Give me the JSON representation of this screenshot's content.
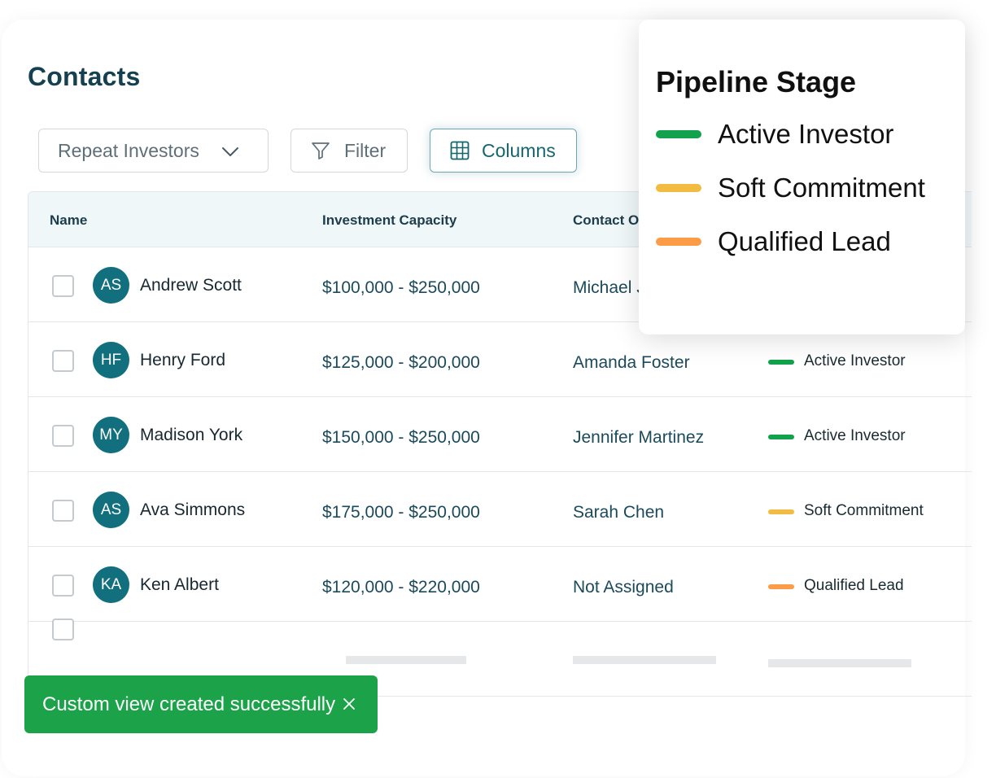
{
  "page": {
    "title": "Contacts"
  },
  "toolbar": {
    "view_select_value": "Repeat Investors",
    "filter_label": "Filter",
    "columns_label": "Columns"
  },
  "table": {
    "headers": [
      "Name",
      "Investment Capacity",
      "Contact O"
    ],
    "rows": [
      {
        "initials": "AS",
        "name": "Andrew Scott",
        "capacity": "$100,000 - $250,000",
        "owner": "Michael J",
        "stage": "",
        "stage_color": ""
      },
      {
        "initials": "HF",
        "name": "Henry Ford",
        "capacity": "$125,000 - $200,000",
        "owner": "Amanda Foster",
        "stage": "Active Investor",
        "stage_color": "#12a14c"
      },
      {
        "initials": "MY",
        "name": "Madison York",
        "capacity": "$150,000 - $250,000",
        "owner": "Jennifer Martinez",
        "stage": "Active Investor",
        "stage_color": "#12a14c"
      },
      {
        "initials": "AS",
        "name": "Ava Simmons",
        "capacity": "$175,000 - $250,000",
        "owner": "Sarah Chen",
        "stage": "Soft Commitment",
        "stage_color": "#f2bb42"
      },
      {
        "initials": "KA",
        "name": "Ken Albert",
        "capacity": "$120,000 - $220,000",
        "owner": "Not Assigned",
        "stage": "Qualified Lead",
        "stage_color": "#fc9c46"
      }
    ]
  },
  "pipeline_popover": {
    "title": "Pipeline Stage",
    "items": [
      {
        "label": "Active Investor",
        "color": "#12a14c"
      },
      {
        "label": "Soft Commitment",
        "color": "#f2bb42"
      },
      {
        "label": "Qualified Lead",
        "color": "#fc9c46"
      }
    ]
  },
  "toast": {
    "message": "Custom view created successfully",
    "close_icon": "close-icon"
  },
  "colors": {
    "brand_teal": "#12707e",
    "success_green": "#1ca34a"
  }
}
